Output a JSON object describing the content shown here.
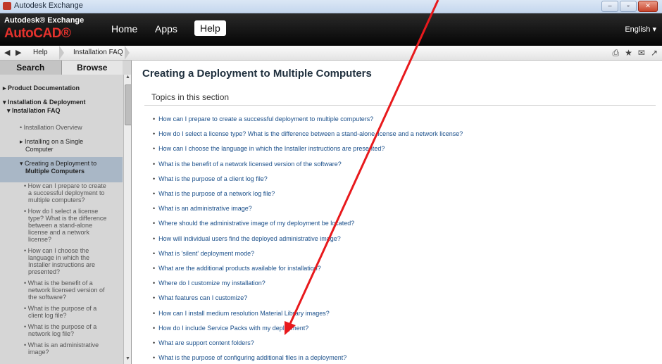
{
  "window": {
    "title": "Autodesk Exchange"
  },
  "topbar": {
    "brand_top": "Autodesk® Exchange",
    "brand_product": "AutoCAD®",
    "nav": [
      "Home",
      "Apps",
      "Help"
    ],
    "language": "English ▾"
  },
  "breadcrumb": {
    "items": [
      "Help",
      "Installation FAQ"
    ]
  },
  "sidebar": {
    "tabs": [
      "Search",
      "Browse"
    ],
    "items": [
      "▸ Product Documentation",
      "▾ Installation & Deployment",
      "▾ Installation FAQ",
      "• Installation Overview",
      "▸ Installing on a Single",
      "Computer",
      "▾ Creating a Deployment to",
      "Multiple Computers",
      "• How can I prepare to create",
      "a successful deployment to",
      "multiple computers?",
      "• How do I select a license",
      "type? What is the difference",
      "between a stand-alone",
      "license and a network",
      "license?",
      "• How can I choose the",
      "language in which the",
      "Installer instructions are",
      "presented?",
      "• What is the benefit of a",
      "network licensed version of",
      "the software?",
      "• What is the purpose of a",
      "client log file?",
      "• What is the purpose of a",
      "network log file?",
      "• What is an administrative",
      "image?"
    ]
  },
  "main": {
    "title": "Creating a Deployment to Multiple Computers",
    "section_heading": "Topics in this section",
    "topics": [
      "How can I prepare to create a successful deployment to multiple computers?",
      "How do I select a license type? What is the difference between a stand-alone license and a network license?",
      "How can I choose the language in which the Installer instructions are presented?",
      "What is the benefit of a network licensed version of the software?",
      "What is the purpose of a client log file?",
      "What is the purpose of a network log file?",
      "What is an administrative image?",
      "Where should the administrative image of my deployment be located?",
      "How will individual users find the deployed administrative image?",
      "What is 'silent' deployment mode?",
      "What are the additional products available for installation?",
      "Where do I customize my installation?",
      "What features can I customize?",
      "How can I install medium resolution Material Library images?",
      "How do I include Service Packs with my deployment?",
      "What are support content folders?",
      "What is the purpose of configuring additional files in a deployment?"
    ]
  },
  "colors": {
    "annotation_arrow": "#e8191c",
    "link": "#1a4f8a",
    "brand_red": "#e5322d"
  }
}
